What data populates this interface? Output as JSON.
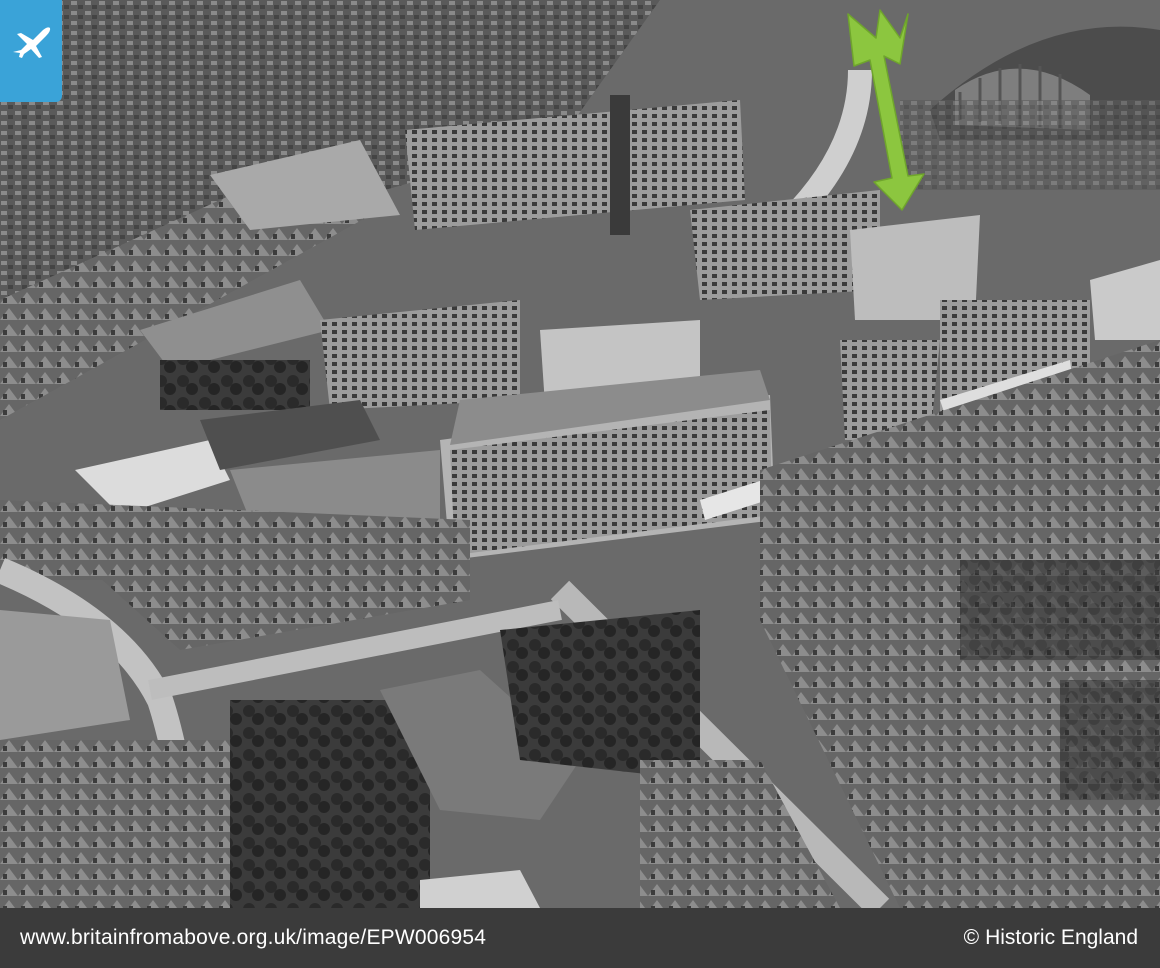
{
  "photo": {
    "subject": "aerial photograph",
    "tone": "black-and-white",
    "marker_color": "#8cc63f",
    "badge_color": "#3aa3d8",
    "badge_icon": "airplane-icon",
    "marker_icon": "arrow-down-icon"
  },
  "footer": {
    "url": "www.britainfromabove.org.uk/image/EPW006954",
    "copyright_symbol": "©",
    "credit": "Historic England"
  }
}
